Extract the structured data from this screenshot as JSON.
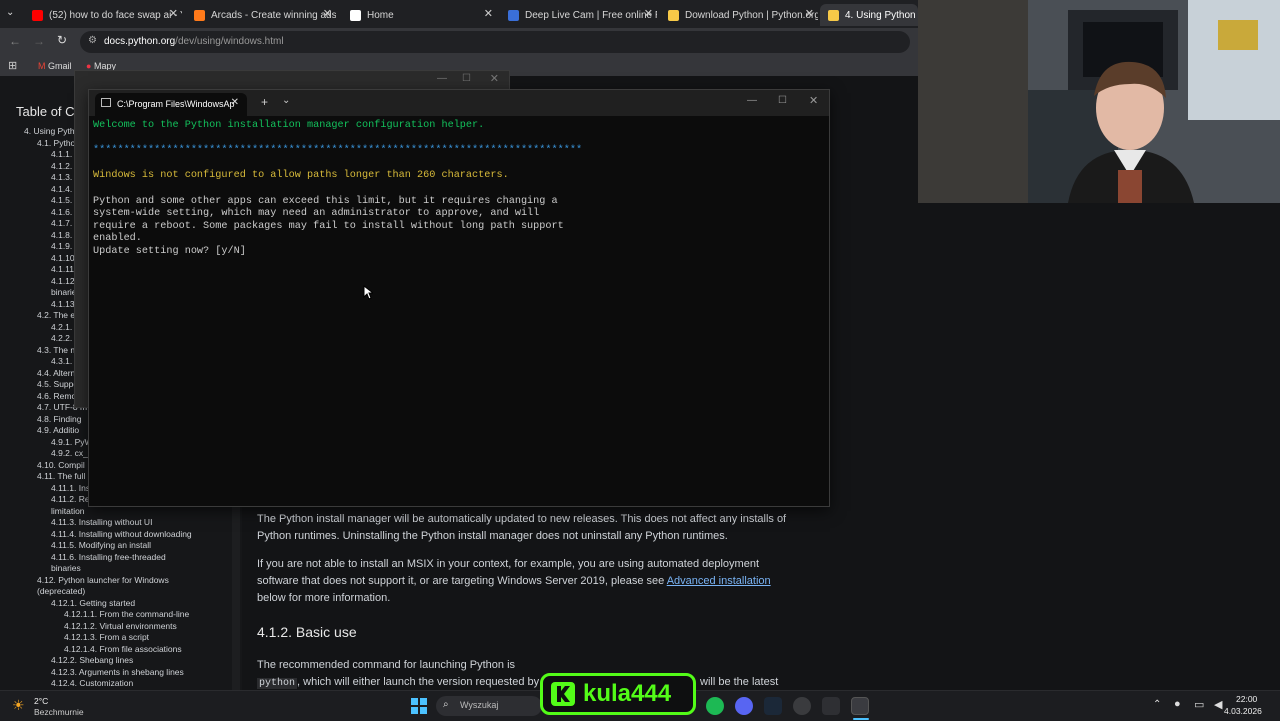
{
  "browser": {
    "tabs": [
      {
        "label": "(52) how to do face swap ai - Y",
        "fav": "#ff0000"
      },
      {
        "label": "Arcads - Create winning ads w",
        "fav": "#ff7a1a"
      },
      {
        "label": "Home",
        "fav": "#ffffff"
      },
      {
        "label": "Deep Live Cam | Free online Re",
        "fav": "#3a6fd8"
      },
      {
        "label": "Download Python | Python.org",
        "fav": "#f7c948"
      },
      {
        "label": "4. Using Python on W",
        "fav": "#f7c948"
      }
    ],
    "url_domain": "docs.python.org",
    "url_path": "/dev/using/windows.html",
    "bookmarks": [
      "Gmail",
      "Mapy"
    ]
  },
  "docs": {
    "toc_title": "Table of Co",
    "toc_items": [
      "4. Using Pyth",
      "4.1. Pytho",
      "4.1.1.",
      "4.1.2.",
      "4.1.3.",
      "4.1.4.",
      "4.1.5.",
      "4.1.6.",
      "4.1.7.",
      "4.1.8.",
      "4.1.9.",
      "4.1.10.",
      "4.1.11",
      "4.1.12.",
      "binarie",
      "4.1.13",
      "4.2. The e",
      "4.2.1.",
      "4.2.2.",
      "4.3. The n",
      "4.3.1.",
      "4.4. Altern",
      "4.5. Suppo",
      "4.6. Remo",
      "4.7. UTF-8 m",
      "4.8. Finding",
      "4.9. Additio",
      "4.9.1. PyW",
      "4.9.2. cx_F",
      "4.10. Compil",
      "4.11. The full",
      "4.11.1. Ins",
      "4.11.2. Re",
      "limitation",
      "4.11.3. Installing without UI",
      "4.11.4. Installing without downloading",
      "4.11.5. Modifying an install",
      "4.11.6. Installing free-threaded",
      "binaries",
      "4.12. Python launcher for Windows",
      "(deprecated)",
      "4.12.1. Getting started",
      "4.12.1.1. From the command-line",
      "4.12.1.2. Virtual environments",
      "4.12.1.3. From a script",
      "4.12.1.4. From file associations",
      "4.12.2. Shebang lines",
      "4.12.3. Arguments in shebang lines",
      "4.12.4. Customization"
    ],
    "para1": "The Python install manager will be automatically updated to new releases. This does not affect any installs of Python runtimes. Uninstalling the Python install manager does not uninstall any Python runtimes.",
    "para2_before": "If you are not able to install an MSIX in your context, for example, you are using automated deployment software that does not support it, or are targeting Windows Server 2019, please see ",
    "para2_link": "Advanced installation",
    "para2_after": " below for more information.",
    "heading": "4.1.2. Basic use",
    "para3_before": "The recommended command for launching Python is ",
    "para3_code": "python",
    "para3_after": ", which will either launch the version requested by the script being launched, an active virtual environment, or t",
    "para3_tail": "will be the latest"
  },
  "terminal": {
    "tab_title": "C:\\Program Files\\WindowsAp",
    "welcome": "Welcome to the Python installation manager configuration helper.",
    "stars": "********************************************************************************",
    "warning": "Windows is not configured to allow paths longer than 260 characters.",
    "line1": "Python and some other apps can exceed this limit, but it requires changing a",
    "line2": "system-wide setting, which may need an administrator to approve, and will",
    "line3": "require a reboot. Some packages may fail to install without long path support",
    "line4": "enabled.",
    "prompt": "Update setting now? [y/N]"
  },
  "overlay": {
    "streamer": "kula444",
    "brand_color": "#53fc18"
  },
  "taskbar": {
    "weather_temp": "2°C",
    "weather_desc": "Bezchmurnie",
    "search_placeholder": "Wyszukaj",
    "time": "22:00",
    "date": "4.03.2026"
  }
}
